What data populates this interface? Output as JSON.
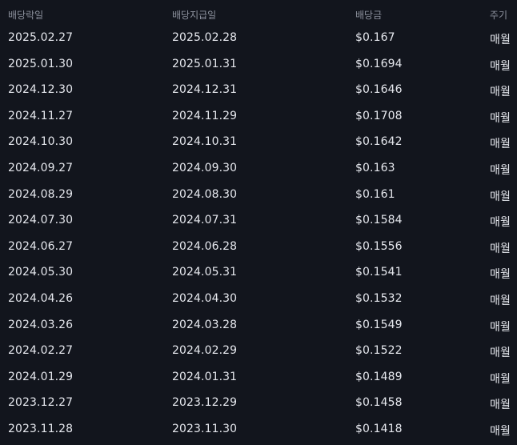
{
  "table": {
    "columns": {
      "ex_date": "배당락일",
      "pay_date": "배당지급일",
      "amount": "배당금",
      "frequency": "주기"
    },
    "rows": [
      {
        "ex_date": "2025.02.27",
        "pay_date": "2025.02.28",
        "amount": "$0.167",
        "frequency": "매월"
      },
      {
        "ex_date": "2025.01.30",
        "pay_date": "2025.01.31",
        "amount": "$0.1694",
        "frequency": "매월"
      },
      {
        "ex_date": "2024.12.30",
        "pay_date": "2024.12.31",
        "amount": "$0.1646",
        "frequency": "매월"
      },
      {
        "ex_date": "2024.11.27",
        "pay_date": "2024.11.29",
        "amount": "$0.1708",
        "frequency": "매월"
      },
      {
        "ex_date": "2024.10.30",
        "pay_date": "2024.10.31",
        "amount": "$0.1642",
        "frequency": "매월"
      },
      {
        "ex_date": "2024.09.27",
        "pay_date": "2024.09.30",
        "amount": "$0.163",
        "frequency": "매월"
      },
      {
        "ex_date": "2024.08.29",
        "pay_date": "2024.08.30",
        "amount": "$0.161",
        "frequency": "매월"
      },
      {
        "ex_date": "2024.07.30",
        "pay_date": "2024.07.31",
        "amount": "$0.1584",
        "frequency": "매월"
      },
      {
        "ex_date": "2024.06.27",
        "pay_date": "2024.06.28",
        "amount": "$0.1556",
        "frequency": "매월"
      },
      {
        "ex_date": "2024.05.30",
        "pay_date": "2024.05.31",
        "amount": "$0.1541",
        "frequency": "매월"
      },
      {
        "ex_date": "2024.04.26",
        "pay_date": "2024.04.30",
        "amount": "$0.1532",
        "frequency": "매월"
      },
      {
        "ex_date": "2024.03.26",
        "pay_date": "2024.03.28",
        "amount": "$0.1549",
        "frequency": "매월"
      },
      {
        "ex_date": "2024.02.27",
        "pay_date": "2024.02.29",
        "amount": "$0.1522",
        "frequency": "매월"
      },
      {
        "ex_date": "2024.01.29",
        "pay_date": "2024.01.31",
        "amount": "$0.1489",
        "frequency": "매월"
      },
      {
        "ex_date": "2023.12.27",
        "pay_date": "2023.12.29",
        "amount": "$0.1458",
        "frequency": "매월"
      },
      {
        "ex_date": "2023.11.28",
        "pay_date": "2023.11.30",
        "amount": "$0.1418",
        "frequency": "매월"
      }
    ]
  },
  "colors": {
    "background": "#12151d",
    "header_text": "#8b909c",
    "cell_text": "#e6e8ee"
  }
}
